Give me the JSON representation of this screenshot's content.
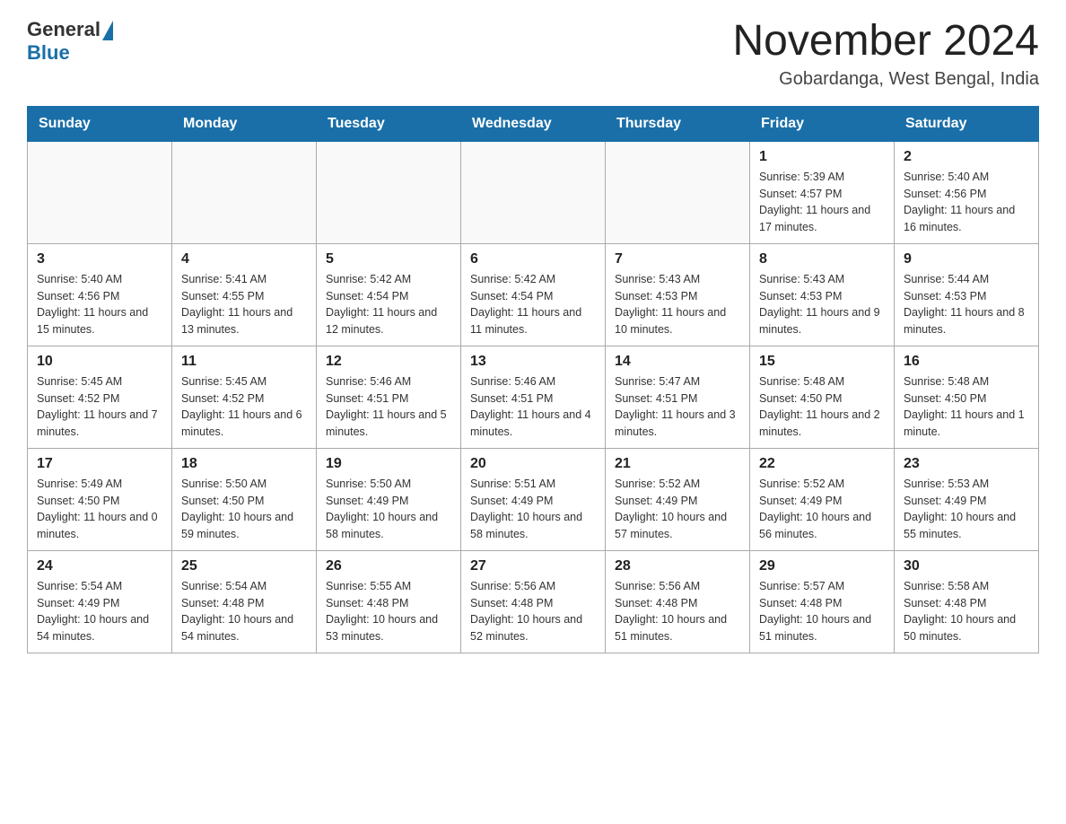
{
  "logo": {
    "text_general": "General",
    "text_blue": "Blue"
  },
  "title": "November 2024",
  "subtitle": "Gobardanga, West Bengal, India",
  "days_of_week": [
    "Sunday",
    "Monday",
    "Tuesday",
    "Wednesday",
    "Thursday",
    "Friday",
    "Saturday"
  ],
  "weeks": [
    [
      {
        "day": "",
        "info": ""
      },
      {
        "day": "",
        "info": ""
      },
      {
        "day": "",
        "info": ""
      },
      {
        "day": "",
        "info": ""
      },
      {
        "day": "",
        "info": ""
      },
      {
        "day": "1",
        "info": "Sunrise: 5:39 AM\nSunset: 4:57 PM\nDaylight: 11 hours and 17 minutes."
      },
      {
        "day": "2",
        "info": "Sunrise: 5:40 AM\nSunset: 4:56 PM\nDaylight: 11 hours and 16 minutes."
      }
    ],
    [
      {
        "day": "3",
        "info": "Sunrise: 5:40 AM\nSunset: 4:56 PM\nDaylight: 11 hours and 15 minutes."
      },
      {
        "day": "4",
        "info": "Sunrise: 5:41 AM\nSunset: 4:55 PM\nDaylight: 11 hours and 13 minutes."
      },
      {
        "day": "5",
        "info": "Sunrise: 5:42 AM\nSunset: 4:54 PM\nDaylight: 11 hours and 12 minutes."
      },
      {
        "day": "6",
        "info": "Sunrise: 5:42 AM\nSunset: 4:54 PM\nDaylight: 11 hours and 11 minutes."
      },
      {
        "day": "7",
        "info": "Sunrise: 5:43 AM\nSunset: 4:53 PM\nDaylight: 11 hours and 10 minutes."
      },
      {
        "day": "8",
        "info": "Sunrise: 5:43 AM\nSunset: 4:53 PM\nDaylight: 11 hours and 9 minutes."
      },
      {
        "day": "9",
        "info": "Sunrise: 5:44 AM\nSunset: 4:53 PM\nDaylight: 11 hours and 8 minutes."
      }
    ],
    [
      {
        "day": "10",
        "info": "Sunrise: 5:45 AM\nSunset: 4:52 PM\nDaylight: 11 hours and 7 minutes."
      },
      {
        "day": "11",
        "info": "Sunrise: 5:45 AM\nSunset: 4:52 PM\nDaylight: 11 hours and 6 minutes."
      },
      {
        "day": "12",
        "info": "Sunrise: 5:46 AM\nSunset: 4:51 PM\nDaylight: 11 hours and 5 minutes."
      },
      {
        "day": "13",
        "info": "Sunrise: 5:46 AM\nSunset: 4:51 PM\nDaylight: 11 hours and 4 minutes."
      },
      {
        "day": "14",
        "info": "Sunrise: 5:47 AM\nSunset: 4:51 PM\nDaylight: 11 hours and 3 minutes."
      },
      {
        "day": "15",
        "info": "Sunrise: 5:48 AM\nSunset: 4:50 PM\nDaylight: 11 hours and 2 minutes."
      },
      {
        "day": "16",
        "info": "Sunrise: 5:48 AM\nSunset: 4:50 PM\nDaylight: 11 hours and 1 minute."
      }
    ],
    [
      {
        "day": "17",
        "info": "Sunrise: 5:49 AM\nSunset: 4:50 PM\nDaylight: 11 hours and 0 minutes."
      },
      {
        "day": "18",
        "info": "Sunrise: 5:50 AM\nSunset: 4:50 PM\nDaylight: 10 hours and 59 minutes."
      },
      {
        "day": "19",
        "info": "Sunrise: 5:50 AM\nSunset: 4:49 PM\nDaylight: 10 hours and 58 minutes."
      },
      {
        "day": "20",
        "info": "Sunrise: 5:51 AM\nSunset: 4:49 PM\nDaylight: 10 hours and 58 minutes."
      },
      {
        "day": "21",
        "info": "Sunrise: 5:52 AM\nSunset: 4:49 PM\nDaylight: 10 hours and 57 minutes."
      },
      {
        "day": "22",
        "info": "Sunrise: 5:52 AM\nSunset: 4:49 PM\nDaylight: 10 hours and 56 minutes."
      },
      {
        "day": "23",
        "info": "Sunrise: 5:53 AM\nSunset: 4:49 PM\nDaylight: 10 hours and 55 minutes."
      }
    ],
    [
      {
        "day": "24",
        "info": "Sunrise: 5:54 AM\nSunset: 4:49 PM\nDaylight: 10 hours and 54 minutes."
      },
      {
        "day": "25",
        "info": "Sunrise: 5:54 AM\nSunset: 4:48 PM\nDaylight: 10 hours and 54 minutes."
      },
      {
        "day": "26",
        "info": "Sunrise: 5:55 AM\nSunset: 4:48 PM\nDaylight: 10 hours and 53 minutes."
      },
      {
        "day": "27",
        "info": "Sunrise: 5:56 AM\nSunset: 4:48 PM\nDaylight: 10 hours and 52 minutes."
      },
      {
        "day": "28",
        "info": "Sunrise: 5:56 AM\nSunset: 4:48 PM\nDaylight: 10 hours and 51 minutes."
      },
      {
        "day": "29",
        "info": "Sunrise: 5:57 AM\nSunset: 4:48 PM\nDaylight: 10 hours and 51 minutes."
      },
      {
        "day": "30",
        "info": "Sunrise: 5:58 AM\nSunset: 4:48 PM\nDaylight: 10 hours and 50 minutes."
      }
    ]
  ]
}
